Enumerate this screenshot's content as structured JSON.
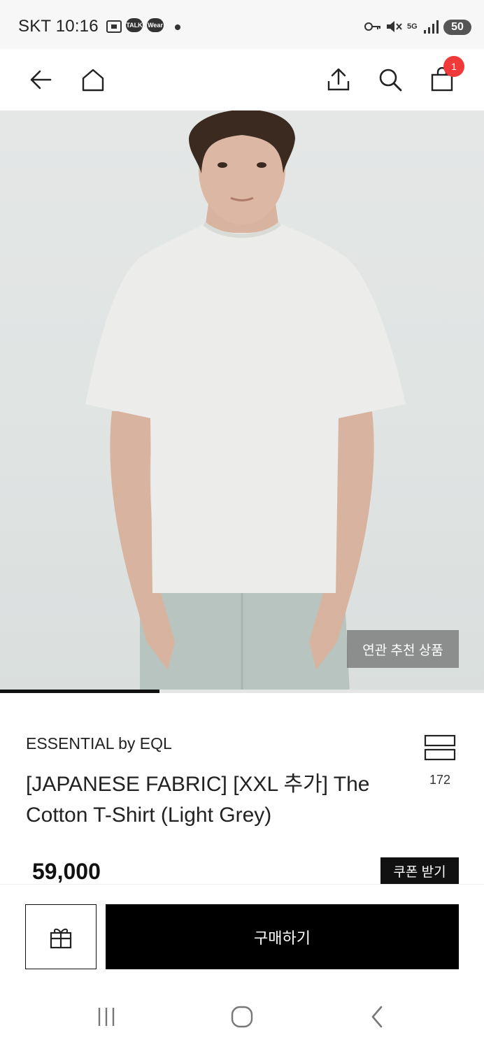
{
  "status_bar": {
    "carrier": "SKT",
    "time": "10:16",
    "talk_label": "TALK",
    "wear_label": "Wear",
    "network": "5G",
    "battery": "50"
  },
  "nav": {
    "cart_count": "1"
  },
  "product": {
    "related_label": "연관 추천 상품",
    "image_progress": 0.33,
    "brand": "ESSENTIAL by EQL",
    "title": "[JAPANESE FABRIC] [XXL 추가] The Cotton T-Shirt (Light Grey)",
    "like_count": "172",
    "price": "59,000",
    "coupon_label": "쿠폰 받기"
  },
  "actions": {
    "buy_label": "구매하기"
  },
  "colors": {
    "badge": "#f03a3a",
    "primary": "#000000",
    "background": "#ffffff"
  }
}
